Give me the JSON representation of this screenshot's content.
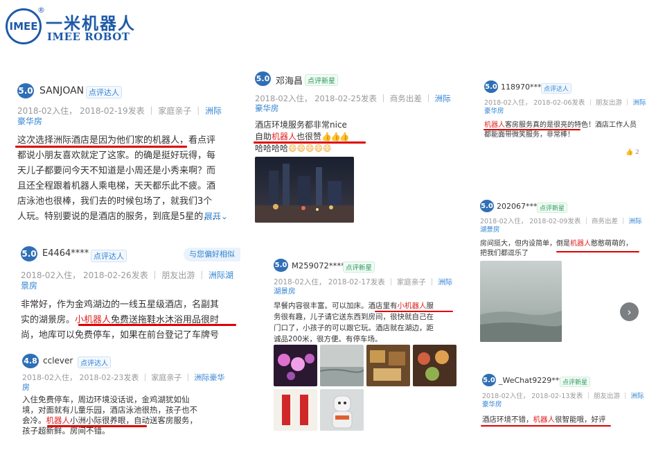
{
  "logo": {
    "circle": "IMEE",
    "reg": "®",
    "cn": "一米机器人",
    "en": "IMEE ROBOT"
  },
  "colors": {
    "brand": "#1e5aa8",
    "badge": "#2f6fb5",
    "link": "#2f82d2",
    "highlight": "#e02020"
  },
  "reviews": [
    {
      "score": "5.0",
      "user": "SANJOAN",
      "tag": "点评达人",
      "meta": "2018-02入住， 2018-02-19发表 ｜ 家庭亲子 ｜ ",
      "room": "洲际豪华房",
      "text_lines": [
        "这次选择洲际酒店是因为他们家的机器人，看点评",
        "都说小朋友喜欢就定了这家。的确是挺好玩得，每",
        "天儿子都要问今天不知道是小周还是小秀来啊？而",
        "且还全程跟着机器人乘电梯，天天都乐此不疲。酒",
        "店泳池也很棒，我们去的时候包场了，就我们3个",
        "人玩。特别要说的是酒店的服务，到底是5星的，…"
      ],
      "expand": "展开"
    },
    {
      "score": "5.0",
      "user": "邓海昌",
      "tag": "点评新星",
      "meta": "2018-02入住， 2018-02-25发表 ｜ 商务出差 ｜ ",
      "room": "洲际豪华房",
      "text_line1": "酒店环境服务都非常nice",
      "text_line2_pre": "自助",
      "text_line2_red": "机器人",
      "text_line2_post": "也很赞",
      "text_line3": "哈哈哈哈"
    },
    {
      "score": "5.0",
      "user": "118970****",
      "tag": "点评达人",
      "meta": "2018-02入住， 2018-02-06发表 ｜ 朋友出游 ｜ ",
      "room": "洲际豪华房",
      "text_red": "机器人",
      "text_line1_post": "客房服务真的是很亮的特色！酒店工作人员",
      "text_line2": "都能面带微笑服务，非常棒！",
      "likes": "2"
    },
    {
      "score": "5.0",
      "user": "202067****",
      "tag": "点评新星",
      "meta": "2018-02入住， 2018-02-09发表 ｜ 商务出差 ｜ ",
      "room": "洲际湖景房",
      "text_line1_pre": "房间挺大，但内设简单，倒是",
      "text_red": "机器人",
      "text_line1_post": "憨憨萌萌的，",
      "text_line2": "把我们都逗乐了",
      "next_icon": "chevron-right-icon"
    },
    {
      "score": "5.0",
      "user": "E4464****",
      "tag": "点评达人",
      "similar_pill": "与您偏好相似",
      "meta": "2018-02入住， 2018-02-26发表 ｜ 朋友出游 ｜ ",
      "room": "洲际湖景房",
      "text_lines": [
        "非常好，作为金鸡湖边的一线五星级酒店，名副其",
        "实的湖景房。"
      ],
      "text_line2_red": "小机器人",
      "text_line2_post": "免费送拖鞋水沐浴用品很时",
      "text_line3": "尚，地库可以免费停车，如果在前台登记了车牌号"
    },
    {
      "score": "5.0",
      "user": "M259072****",
      "tag": "点评新星",
      "meta": "2018-02入住， 2018-02-17发表 ｜ 家庭亲子 ｜ ",
      "room": "洲际湖景房",
      "text_line1_pre": "早餐内容很丰富。可以加床。",
      "text_line1_mid": "酒店里有",
      "text_red": "小机器人",
      "text_line1_post": "服",
      "text_lines": [
        "务很有趣，儿子请它送东西到房间，很快就自己在",
        "门口了，小孩子的可以跟它玩。酒店就在湖边，距",
        "诚品200米，很方便。有停车场。"
      ]
    },
    {
      "score": "4.8",
      "user": "cclever",
      "tag": "点评达人",
      "meta": "2018-02入住， 2018-02-23发表 ｜ 家庭亲子 ｜ ",
      "room": "洲际豪华房",
      "text_lines": [
        "入住免费停车，周边环境没话说，金鸡湖犹如仙",
        "境，对面就有儿童乐园，酒店泳池很热，孩子也不",
        "会冷。"
      ],
      "text_line3_red": "机器人",
      "text_line3_post": "小洲小际很养眼",
      "text_line3_tail": "，自动送客房服务，",
      "text_line4": "孩子超新鲜。房间不错。"
    },
    {
      "score": "5.0",
      "user": "_WeChat9229****",
      "tag": "点评新星",
      "meta": "2018-02入住， 2018-02-13发表 ｜ 朋友出游 ｜ ",
      "room": "洲际豪华房",
      "text_pre": "酒店环境不错，",
      "text_red": "机器人",
      "text_post": "很智能哦，好评"
    }
  ]
}
